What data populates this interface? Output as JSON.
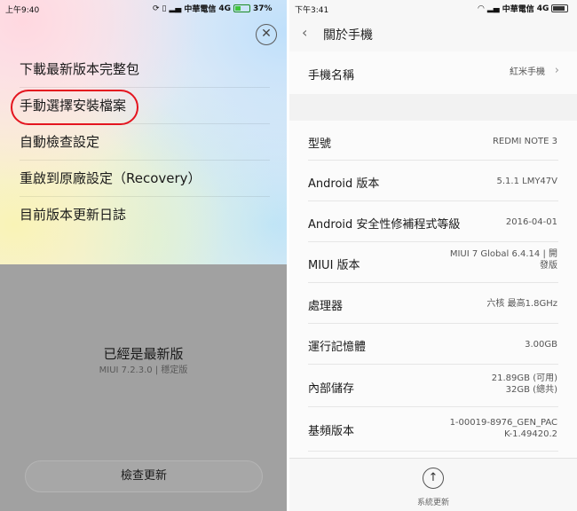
{
  "left": {
    "status_time": "上午9:40",
    "carrier": "中華電信",
    "network": "4G",
    "battery": "37%",
    "battery_level": 0.37,
    "close_icon": "close-icon",
    "menu": [
      "下載最新版本完整包",
      "手動選擇安裝檔案",
      "自動檢查設定",
      "重啟到原廠設定（Recovery）",
      "目前版本更新日誌"
    ],
    "highlight_color": "#e4151f",
    "status_title": "已經是最新版",
    "status_sub": "MIUI 7.2.3.0 | 穩定版",
    "check_button": "檢查更新"
  },
  "right": {
    "status_time": "下午3:41",
    "carrier": "中華電信",
    "network": "4G",
    "battery_level": 0.85,
    "back_icon": "chevron-left-icon",
    "title": "關於手機",
    "rows": [
      {
        "label": "手機名稱",
        "value": "紅米手機"
      },
      {
        "label": "型號",
        "value": "REDMI NOTE 3"
      },
      {
        "label": "Android 版本",
        "value": "5.1.1 LMY47V"
      },
      {
        "label": "Android 安全性修補程式等級",
        "value": "2016-04-01"
      },
      {
        "label": "MIUI 版本",
        "value1": "MIUI 7 Global 6.4.14 | 開",
        "value2": "發版"
      },
      {
        "label": "處理器",
        "value": "六核 最高1.8GHz"
      },
      {
        "label": "運行記憶體",
        "value": "3.00GB"
      },
      {
        "label": "內部儲存",
        "value1": "21.89GB (可用)",
        "value2": "32GB (總共)"
      },
      {
        "label": "基頻版本",
        "value1": "1-00019-8976_GEN_PAC",
        "value2": "K-1.49420.2"
      }
    ],
    "footer_label": "系統更新",
    "footer_icon": "arrow-up-icon"
  }
}
